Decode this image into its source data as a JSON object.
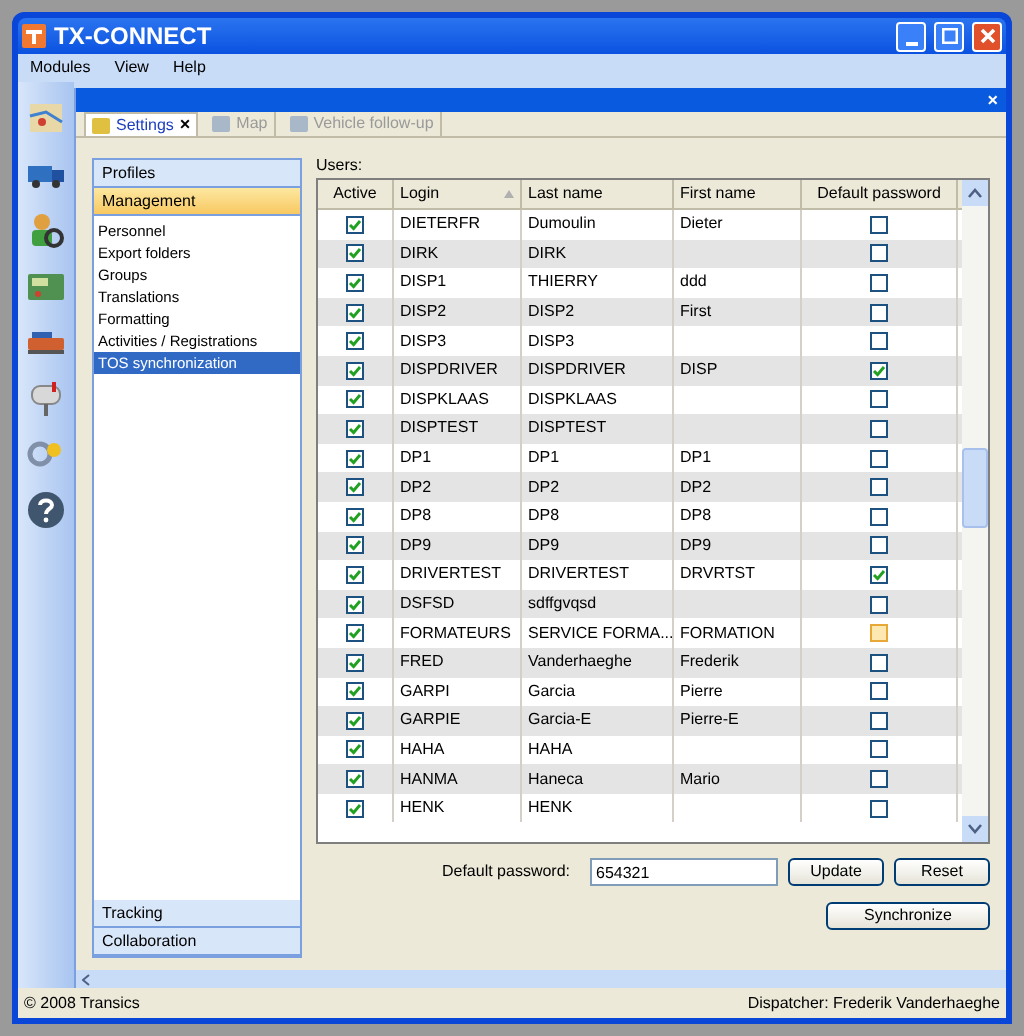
{
  "window": {
    "title": "TX-CONNECT"
  },
  "menu": [
    "Modules",
    "View",
    "Help"
  ],
  "panel_close": "×",
  "tab_close": "×",
  "tabs": [
    {
      "label": "Settings",
      "selected": true,
      "closable": true
    },
    {
      "label": "Map",
      "selected": false,
      "closable": false
    },
    {
      "label": "Vehicle follow-up",
      "selected": false,
      "closable": false
    }
  ],
  "sidebar": {
    "sections_top": [
      {
        "label": "Profiles",
        "selected": false
      },
      {
        "label": "Management",
        "selected": true
      }
    ],
    "items": [
      {
        "label": "Personnel",
        "selected": false
      },
      {
        "label": "Export folders",
        "selected": false
      },
      {
        "label": "Groups",
        "selected": false
      },
      {
        "label": "Translations",
        "selected": false
      },
      {
        "label": "Formatting",
        "selected": false
      },
      {
        "label": "Activities / Registrations",
        "selected": false
      },
      {
        "label": "TOS synchronization",
        "selected": true
      }
    ],
    "sections_bottom": [
      {
        "label": "Tracking",
        "selected": false
      },
      {
        "label": "Collaboration",
        "selected": false
      }
    ]
  },
  "users_label": "Users:",
  "table": {
    "columns": [
      {
        "label": "Active",
        "sorted": false
      },
      {
        "label": "Login",
        "sorted": true
      },
      {
        "label": "Last name",
        "sorted": false
      },
      {
        "label": "First name",
        "sorted": false
      },
      {
        "label": "Default password",
        "sorted": false
      }
    ],
    "rows": [
      {
        "active": true,
        "login": "DIETERFR",
        "last_name": "Dumoulin",
        "first_name": "Dieter",
        "default_password": false,
        "hovered": false
      },
      {
        "active": true,
        "login": "DIRK",
        "last_name": "DIRK",
        "default_password": false,
        "hovered": false
      },
      {
        "active": true,
        "login": "DISP1",
        "last_name": "THIERRY",
        "first_name": "ddd",
        "default_password": false,
        "hovered": false
      },
      {
        "active": true,
        "login": "DISP2",
        "last_name": "DISP2",
        "first_name": "First",
        "default_password": false,
        "hovered": false
      },
      {
        "active": true,
        "login": "DISP3",
        "last_name": "DISP3",
        "default_password": false,
        "hovered": false
      },
      {
        "active": true,
        "login": "DISPDRIVER",
        "last_name": "DISPDRIVER",
        "first_name": "DISP",
        "default_password": true,
        "hovered": false
      },
      {
        "active": true,
        "login": "DISPKLAAS",
        "last_name": "DISPKLAAS",
        "default_password": false,
        "hovered": false
      },
      {
        "active": true,
        "login": "DISPTEST",
        "last_name": "DISPTEST",
        "default_password": false,
        "hovered": false
      },
      {
        "active": true,
        "login": "DP1",
        "last_name": "DP1",
        "first_name": "DP1",
        "default_password": false,
        "hovered": false
      },
      {
        "active": true,
        "login": "DP2",
        "last_name": "DP2",
        "first_name": "DP2",
        "default_password": false,
        "hovered": false
      },
      {
        "active": true,
        "login": "DP8",
        "last_name": "DP8",
        "first_name": "DP8",
        "default_password": false,
        "hovered": false
      },
      {
        "active": true,
        "login": "DP9",
        "last_name": "DP9",
        "first_name": "DP9",
        "default_password": false,
        "hovered": false
      },
      {
        "active": true,
        "login": "DRIVERTEST",
        "last_name": "DRIVERTEST",
        "first_name": "DRVRTST",
        "default_password": true,
        "hovered": false
      },
      {
        "active": true,
        "login": "DSFSD",
        "last_name": "sdffgvqsd",
        "default_password": false,
        "hovered": false
      },
      {
        "active": true,
        "login": "FORMATEURS",
        "last_name": "SERVICE FORMA...",
        "first_name": "FORMATION",
        "default_password": false,
        "hovered": true
      },
      {
        "active": true,
        "login": "FRED",
        "last_name": "Vanderhaeghe",
        "first_name": "Frederik",
        "default_password": false,
        "hovered": false
      },
      {
        "active": true,
        "login": "GARPI",
        "last_name": "Garcia",
        "first_name": "Pierre",
        "default_password": false,
        "hovered": false
      },
      {
        "active": true,
        "login": "GARPIE",
        "last_name": "Garcia-E",
        "first_name": "Pierre-E",
        "default_password": false,
        "hovered": false
      },
      {
        "active": true,
        "login": "HAHA",
        "last_name": "HAHA",
        "default_password": false,
        "hovered": false
      },
      {
        "active": true,
        "login": "HANMA",
        "last_name": "Haneca",
        "first_name": "Mario",
        "default_password": false,
        "hovered": false
      },
      {
        "active": true,
        "login": "HENK",
        "last_name": "HENK",
        "default_password": false,
        "hovered": false
      }
    ]
  },
  "default_password": {
    "label": "Default password:",
    "value": "654321"
  },
  "buttons": [
    "Update",
    "Reset"
  ],
  "sync_button": "Synchronize",
  "status_bar": {
    "left": "© 2008 Transics",
    "right": "Dispatcher: Frederik Vanderhaeghe"
  }
}
